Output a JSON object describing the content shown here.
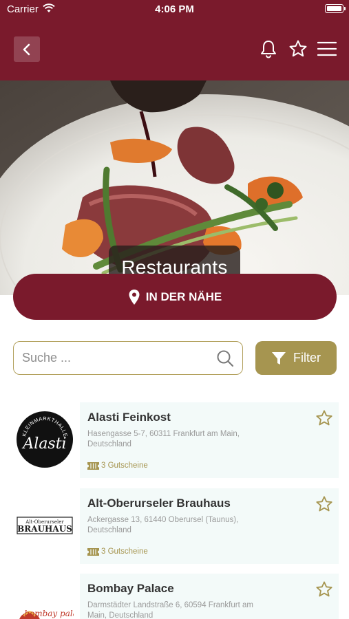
{
  "status": {
    "carrier": "Carrier",
    "time": "4:06 PM"
  },
  "header": {
    "back_icon": "chevron-left-icon",
    "bell_icon": "bell-icon",
    "favorites_icon": "star-outline-icon",
    "menu_icon": "hamburger-menu-icon"
  },
  "hero": {
    "title": "Restaurants"
  },
  "near_me": {
    "label": "IN DER NÄHE",
    "icon": "map-pin-icon"
  },
  "search": {
    "placeholder": "Suche ...",
    "value": ""
  },
  "filter": {
    "label": "Filter",
    "icon": "funnel-icon"
  },
  "restaurants": [
    {
      "name": "Alasti Feinkost",
      "address": "Hasengasse 5-7, 60311 Frankfurt am Main, Deutschland",
      "vouchers": "3 Gutscheine",
      "logo_text": "Alasti",
      "logo_ring": "KLEINMARKTHALLE"
    },
    {
      "name": "Alt-Oberurseler Brauhaus",
      "address": "Ackergasse 13, 61440 Oberursel (Taunus), Deutschland",
      "vouchers": "3 Gutscheine",
      "logo_text": "BRAUHAUS",
      "logo_sub": "Alt-Oberurseler"
    },
    {
      "name": "Bombay Palace",
      "address": "Darmstädter Landstraße 6, 60594 Frankfurt am Main, Deutschland",
      "vouchers": "",
      "logo_text": "bombay palace"
    }
  ],
  "colors": {
    "brand": "#7a1a2c",
    "gold": "#a69550",
    "card_bg": "#f3faf9"
  }
}
